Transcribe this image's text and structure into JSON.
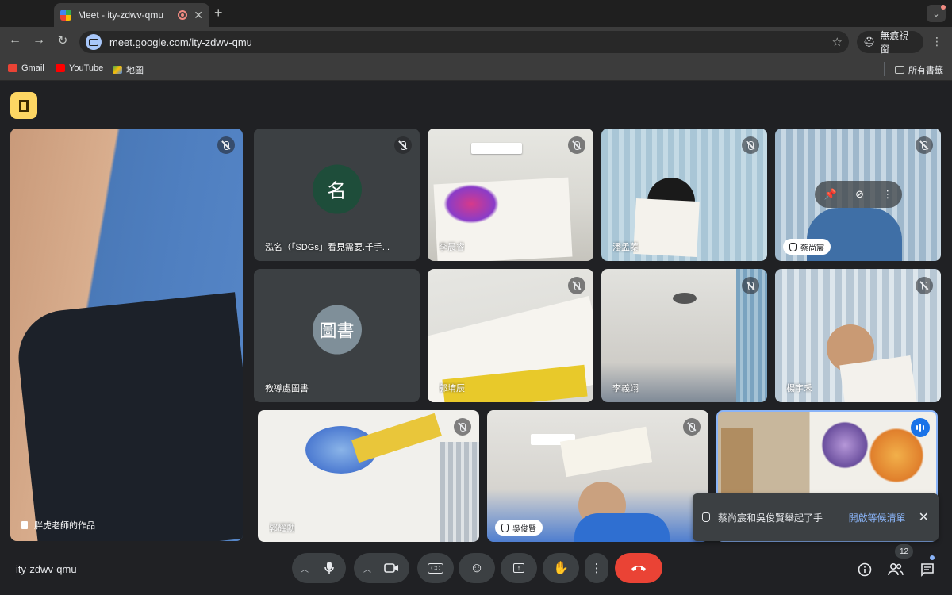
{
  "browser": {
    "tab_title": "Meet - ity-zdwv-qmu",
    "url": "meet.google.com/ity-zdwv-qmu",
    "incognito_label": "無痕視窗",
    "bookmarks": [
      {
        "label": "Gmail",
        "color": "#ea4335"
      },
      {
        "label": "YouTube",
        "color": "#ff0000"
      },
      {
        "label": "地圖",
        "color": "#34a853"
      }
    ],
    "all_bookmarks": "所有書籤"
  },
  "tiles": {
    "pinned": {
      "name": "胖虎老師的作品"
    },
    "t1": {
      "name": "泓名（「SDGs」看見需要.千手...",
      "initial": "名",
      "avatar_color": "#1e4d3a"
    },
    "t2": {
      "name": "李晨睿"
    },
    "t3": {
      "name": "潘孟蓁"
    },
    "t4": {
      "name": "蔡尚宸"
    },
    "t5": {
      "name": "教導處圖書",
      "initial": "圖書",
      "avatar_color": "#7f8f99"
    },
    "t6": {
      "name": "郭堉辰"
    },
    "t7": {
      "name": "李義翊"
    },
    "t8": {
      "name": "楊宇禾"
    },
    "t9": {
      "name": "郭耀勳"
    },
    "t10": {
      "name": "吳俊賢"
    },
    "t11": {
      "name": ""
    }
  },
  "toast": {
    "message": "蔡尚宸和吳俊賢舉起了手",
    "action": "開啟等候清單"
  },
  "bottom": {
    "meeting_code": "ity-zdwv-qmu",
    "participant_count": "12"
  }
}
